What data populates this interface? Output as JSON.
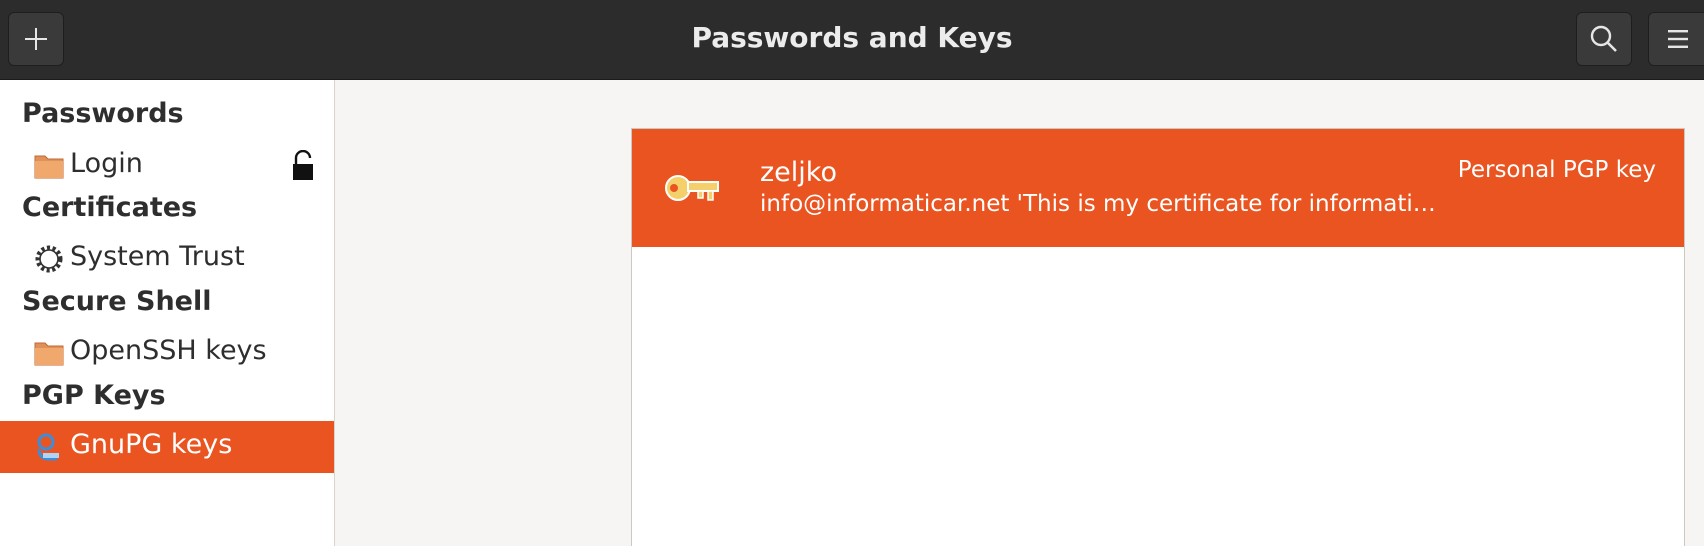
{
  "window": {
    "title": "Passwords and Keys"
  },
  "header": {
    "add_icon": "plus-icon",
    "search_icon": "search-icon",
    "menu_icon": "hamburger-menu-icon"
  },
  "sidebar": {
    "sections": [
      {
        "title": "Passwords",
        "items": [
          {
            "label": "Login",
            "icon": "folder-icon",
            "locked_icon": "unlocked-padlock-icon"
          }
        ]
      },
      {
        "title": "Certificates",
        "items": [
          {
            "label": "System Trust",
            "icon": "gear-icon"
          }
        ]
      },
      {
        "title": "Secure Shell",
        "items": [
          {
            "label": "OpenSSH keys",
            "icon": "folder-icon"
          }
        ]
      },
      {
        "title": "PGP Keys",
        "items": [
          {
            "label": "GnuPG keys",
            "icon": "keyring-icon",
            "selected": true
          }
        ]
      }
    ]
  },
  "keys": [
    {
      "name": "zeljko",
      "description": "info@informaticar.net 'This is my certificate for informaticar.net'",
      "type": "Personal PGP key",
      "icon": "key-icon"
    }
  ],
  "colors": {
    "accent": "#e95420",
    "header_bg": "#2c2c2c"
  }
}
